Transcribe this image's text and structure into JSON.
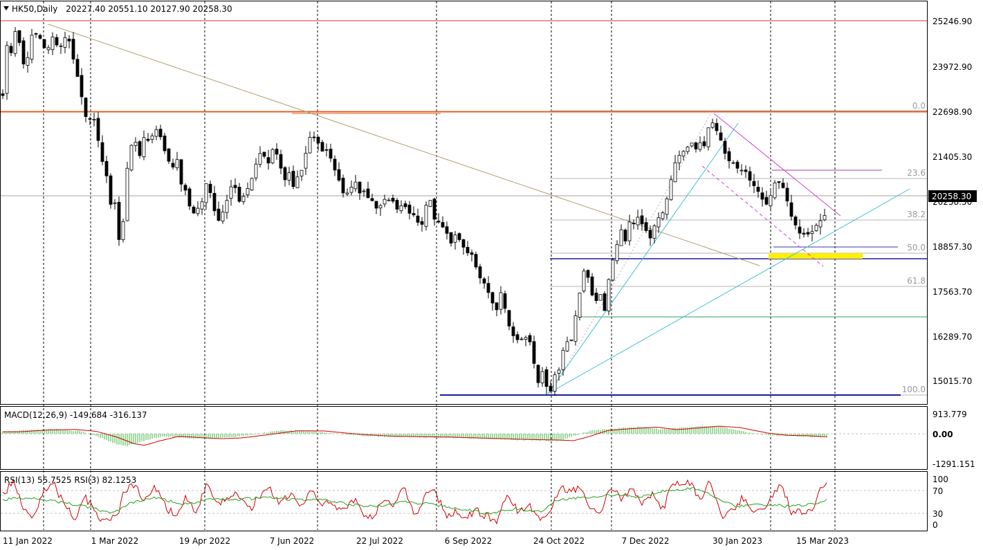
{
  "header": {
    "arrow_icon": "triangle-down-icon",
    "symbol": "HK50,Daily",
    "ohlc": "20227.40 20551.10 20127.90 20258.30"
  },
  "macd": {
    "title": "MACD(12,26,9) -149.684 -316.137",
    "ticks": [
      "913.779",
      "0.00",
      "-1291.151"
    ]
  },
  "rsi": {
    "title": "RSI(13) 55.7525  RSI(3) 82.1253",
    "ticks": [
      "100",
      "70",
      "30",
      "0"
    ]
  },
  "price_axis": {
    "ticks": [
      "25246.90",
      "23972.90",
      "22698.90",
      "21405.30",
      "20258.30",
      "18857.30",
      "17563.70",
      "16289.70",
      "15015.70"
    ],
    "current": "20258.30"
  },
  "fibonacci": {
    "levels": [
      "0.0",
      "23.6",
      "38.2",
      "50.0",
      "61.8",
      "100.0"
    ]
  },
  "chart_data": {
    "type": "candlestick",
    "symbol": "HK50",
    "timeframe": "Daily",
    "x_labels": [
      "11 Jan 2022",
      "1 Mar 2022",
      "19 Apr 2022",
      "7 Jun 2022",
      "22 Jul 2022",
      "6 Sep 2022",
      "24 Oct 2022",
      "7 Dec 2022",
      "30 Jan 2023",
      "15 Mar 2023"
    ],
    "last_bar": {
      "open": 20227.4,
      "high": 20551.1,
      "low": 20127.9,
      "close": 20258.3
    },
    "ylim": [
      14700,
      25600
    ],
    "price_path": [
      [
        0,
        23300
      ],
      [
        4,
        24700
      ],
      [
        9,
        24400
      ],
      [
        14,
        24500
      ],
      [
        20,
        25200
      ],
      [
        28,
        24300
      ],
      [
        32,
        23700
      ],
      [
        42,
        24900
      ],
      [
        48,
        25000
      ],
      [
        58,
        24700
      ],
      [
        64,
        24400
      ],
      [
        72,
        24900
      ],
      [
        80,
        24600
      ],
      [
        92,
        24800
      ],
      [
        100,
        24500
      ],
      [
        108,
        23700
      ],
      [
        116,
        23000
      ],
      [
        122,
        22500
      ],
      [
        130,
        22700
      ],
      [
        138,
        21900
      ],
      [
        146,
        21300
      ],
      [
        152,
        20700
      ],
      [
        158,
        19800
      ],
      [
        162,
        20300
      ],
      [
        167,
        19300
      ],
      [
        171,
        18900
      ],
      [
        174,
        19700
      ],
      [
        178,
        20800
      ],
      [
        184,
        21700
      ],
      [
        192,
        21900
      ],
      [
        198,
        21600
      ],
      [
        206,
        22100
      ],
      [
        214,
        21900
      ],
      [
        222,
        22300
      ],
      [
        228,
        22000
      ],
      [
        236,
        21600
      ],
      [
        244,
        21100
      ],
      [
        252,
        21400
      ],
      [
        258,
        20800
      ],
      [
        266,
        20400
      ],
      [
        274,
        19900
      ],
      [
        282,
        20100
      ],
      [
        288,
        20300
      ],
      [
        296,
        20900
      ],
      [
        302,
        20400
      ],
      [
        310,
        19700
      ],
      [
        318,
        19900
      ],
      [
        326,
        20400
      ],
      [
        334,
        20800
      ],
      [
        342,
        20300
      ],
      [
        350,
        20500
      ],
      [
        358,
        20800
      ],
      [
        366,
        21300
      ],
      [
        374,
        21600
      ],
      [
        382,
        21300
      ],
      [
        392,
        21800
      ],
      [
        400,
        21300
      ],
      [
        408,
        20800
      ],
      [
        414,
        21100
      ],
      [
        420,
        20700
      ],
      [
        428,
        21000
      ],
      [
        436,
        21400
      ],
      [
        442,
        21900
      ],
      [
        448,
        22200
      ],
      [
        452,
        21800
      ],
      [
        458,
        22000
      ],
      [
        464,
        21500
      ],
      [
        470,
        21800
      ],
      [
        476,
        21300
      ],
      [
        482,
        21000
      ],
      [
        488,
        20700
      ],
      [
        494,
        20400
      ],
      [
        500,
        20600
      ],
      [
        508,
        20800
      ],
      [
        516,
        20500
      ],
      [
        524,
        20600
      ],
      [
        532,
        20300
      ],
      [
        540,
        20100
      ],
      [
        548,
        20200
      ],
      [
        556,
        20300
      ],
      [
        564,
        20200
      ],
      [
        572,
        20100
      ],
      [
        580,
        20200
      ],
      [
        588,
        19900
      ],
      [
        596,
        19800
      ],
      [
        604,
        19500
      ],
      [
        612,
        20100
      ],
      [
        618,
        20300
      ],
      [
        624,
        19800
      ],
      [
        632,
        19600
      ],
      [
        640,
        19400
      ],
      [
        648,
        19100
      ],
      [
        656,
        19300
      ],
      [
        664,
        19000
      ],
      [
        672,
        18900
      ],
      [
        680,
        18800
      ],
      [
        688,
        18200
      ],
      [
        696,
        17900
      ],
      [
        704,
        17600
      ],
      [
        712,
        17100
      ],
      [
        718,
        17700
      ],
      [
        724,
        17600
      ],
      [
        730,
        16900
      ],
      [
        738,
        16500
      ],
      [
        746,
        16300
      ],
      [
        754,
        16600
      ],
      [
        760,
        16400
      ],
      [
        766,
        16000
      ],
      [
        772,
        15200
      ],
      [
        780,
        15600
      ],
      [
        786,
        15200
      ],
      [
        792,
        15000
      ],
      [
        798,
        15500
      ],
      [
        804,
        15600
      ],
      [
        810,
        16100
      ],
      [
        816,
        16400
      ],
      [
        822,
        16500
      ],
      [
        828,
        17100
      ],
      [
        834,
        17800
      ],
      [
        840,
        18300
      ],
      [
        846,
        18100
      ],
      [
        852,
        17600
      ],
      [
        858,
        17500
      ],
      [
        864,
        17700
      ],
      [
        870,
        17300
      ],
      [
        876,
        18100
      ],
      [
        882,
        18700
      ],
      [
        888,
        19100
      ],
      [
        894,
        19400
      ],
      [
        900,
        19200
      ],
      [
        906,
        19700
      ],
      [
        912,
        19600
      ],
      [
        920,
        19800
      ],
      [
        928,
        19500
      ],
      [
        936,
        19300
      ],
      [
        944,
        19700
      ],
      [
        952,
        19800
      ],
      [
        960,
        20300
      ],
      [
        966,
        20900
      ],
      [
        972,
        21400
      ],
      [
        978,
        21600
      ],
      [
        986,
        21700
      ],
      [
        994,
        21900
      ],
      [
        1002,
        21800
      ],
      [
        1010,
        22000
      ],
      [
        1016,
        21800
      ],
      [
        1022,
        22500
      ],
      [
        1028,
        22400
      ],
      [
        1034,
        22100
      ],
      [
        1040,
        21800
      ],
      [
        1046,
        21500
      ],
      [
        1052,
        21400
      ],
      [
        1060,
        21300
      ],
      [
        1068,
        21100
      ],
      [
        1076,
        21000
      ],
      [
        1084,
        20800
      ],
      [
        1090,
        20700
      ],
      [
        1096,
        20400
      ],
      [
        1102,
        20100
      ],
      [
        1108,
        20200
      ],
      [
        1114,
        20700
      ],
      [
        1120,
        20900
      ],
      [
        1126,
        20800
      ],
      [
        1132,
        20500
      ],
      [
        1138,
        20000
      ],
      [
        1144,
        19600
      ],
      [
        1150,
        19500
      ],
      [
        1156,
        19400
      ],
      [
        1162,
        19300
      ],
      [
        1168,
        19200
      ],
      [
        1174,
        19600
      ],
      [
        1180,
        19800
      ],
      [
        1186,
        19700
      ],
      [
        1192,
        20000
      ],
      [
        1196,
        20258
      ]
    ],
    "macd_path": [
      [
        0,
        120
      ],
      [
        40,
        230
      ],
      [
        80,
        260
      ],
      [
        110,
        150
      ],
      [
        140,
        -200
      ],
      [
        165,
        -600
      ],
      [
        180,
        -700
      ],
      [
        200,
        -450
      ],
      [
        230,
        -150
      ],
      [
        260,
        -230
      ],
      [
        290,
        -300
      ],
      [
        320,
        -250
      ],
      [
        360,
        -50
      ],
      [
        400,
        180
      ],
      [
        440,
        170
      ],
      [
        470,
        50
      ],
      [
        500,
        -60
      ],
      [
        540,
        -150
      ],
      [
        580,
        -180
      ],
      [
        620,
        -200
      ],
      [
        660,
        -250
      ],
      [
        700,
        -300
      ],
      [
        740,
        -350
      ],
      [
        780,
        -380
      ],
      [
        800,
        -420
      ],
      [
        820,
        -200
      ],
      [
        850,
        200
      ],
      [
        880,
        300
      ],
      [
        920,
        400
      ],
      [
        950,
        250
      ],
      [
        980,
        350
      ],
      [
        1010,
        460
      ],
      [
        1040,
        380
      ],
      [
        1080,
        50
      ],
      [
        1110,
        -100
      ],
      [
        1140,
        -120
      ],
      [
        1170,
        -200
      ],
      [
        1196,
        -150
      ]
    ],
    "rsi_path": [
      [
        0,
        70
      ],
      [
        15,
        90
      ],
      [
        30,
        40
      ],
      [
        45,
        20
      ],
      [
        60,
        80
      ],
      [
        75,
        85
      ],
      [
        90,
        40
      ],
      [
        105,
        15
      ],
      [
        120,
        60
      ],
      [
        135,
        20
      ],
      [
        150,
        10
      ],
      [
        165,
        15
      ],
      [
        175,
        75
      ],
      [
        190,
        85
      ],
      [
        205,
        50
      ],
      [
        220,
        85
      ],
      [
        235,
        40
      ],
      [
        250,
        20
      ],
      [
        265,
        60
      ],
      [
        280,
        30
      ],
      [
        295,
        85
      ],
      [
        310,
        40
      ],
      [
        325,
        60
      ],
      [
        340,
        70
      ],
      [
        355,
        30
      ],
      [
        370,
        60
      ],
      [
        385,
        80
      ],
      [
        400,
        45
      ],
      [
        415,
        70
      ],
      [
        430,
        35
      ],
      [
        445,
        80
      ],
      [
        460,
        40
      ],
      [
        475,
        50
      ],
      [
        490,
        25
      ],
      [
        505,
        60
      ],
      [
        520,
        30
      ],
      [
        535,
        10
      ],
      [
        550,
        60
      ],
      [
        565,
        40
      ],
      [
        580,
        80
      ],
      [
        595,
        20
      ],
      [
        610,
        60
      ],
      [
        625,
        75
      ],
      [
        640,
        20
      ],
      [
        655,
        30
      ],
      [
        670,
        15
      ],
      [
        685,
        30
      ],
      [
        700,
        20
      ],
      [
        715,
        10
      ],
      [
        730,
        70
      ],
      [
        745,
        25
      ],
      [
        760,
        50
      ],
      [
        775,
        15
      ],
      [
        790,
        25
      ],
      [
        805,
        85
      ],
      [
        820,
        75
      ],
      [
        835,
        80
      ],
      [
        850,
        40
      ],
      [
        865,
        30
      ],
      [
        880,
        85
      ],
      [
        895,
        50
      ],
      [
        910,
        80
      ],
      [
        925,
        45
      ],
      [
        940,
        70
      ],
      [
        955,
        30
      ],
      [
        965,
        90
      ],
      [
        980,
        95
      ],
      [
        995,
        90
      ],
      [
        1010,
        50
      ],
      [
        1022,
        95
      ],
      [
        1040,
        20
      ],
      [
        1055,
        30
      ],
      [
        1070,
        60
      ],
      [
        1085,
        20
      ],
      [
        1100,
        40
      ],
      [
        1115,
        70
      ],
      [
        1128,
        85
      ],
      [
        1140,
        20
      ],
      [
        1155,
        30
      ],
      [
        1170,
        25
      ],
      [
        1180,
        80
      ],
      [
        1190,
        85
      ],
      [
        1196,
        82
      ]
    ],
    "rsi_signal_path": [
      [
        0,
        55
      ],
      [
        40,
        60
      ],
      [
        80,
        50
      ],
      [
        120,
        40
      ],
      [
        160,
        25
      ],
      [
        180,
        45
      ],
      [
        220,
        60
      ],
      [
        260,
        45
      ],
      [
        300,
        55
      ],
      [
        340,
        55
      ],
      [
        380,
        60
      ],
      [
        420,
        55
      ],
      [
        460,
        55
      ],
      [
        500,
        45
      ],
      [
        540,
        40
      ],
      [
        580,
        50
      ],
      [
        620,
        45
      ],
      [
        660,
        35
      ],
      [
        700,
        25
      ],
      [
        740,
        35
      ],
      [
        780,
        30
      ],
      [
        800,
        55
      ],
      [
        840,
        60
      ],
      [
        880,
        65
      ],
      [
        920,
        60
      ],
      [
        960,
        75
      ],
      [
        1000,
        80
      ],
      [
        1030,
        60
      ],
      [
        1060,
        40
      ],
      [
        1100,
        45
      ],
      [
        1140,
        40
      ],
      [
        1170,
        45
      ],
      [
        1196,
        55
      ]
    ]
  }
}
